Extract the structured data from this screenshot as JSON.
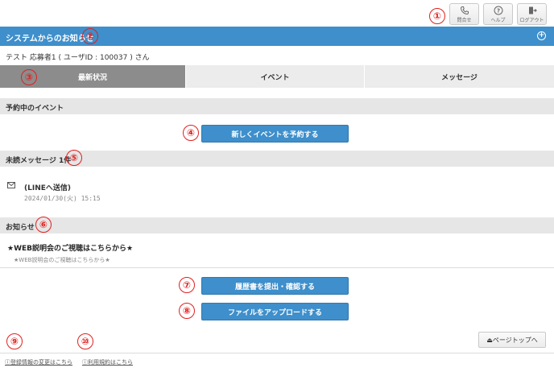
{
  "header": {
    "logo_text": "",
    "buttons": [
      {
        "label": "問合せ",
        "icon": "phone-icon"
      },
      {
        "label": "ヘルプ",
        "icon": "help-icon"
      },
      {
        "label": "ログアウト",
        "icon": "logout-icon"
      }
    ]
  },
  "banner": {
    "title": "システムからのお知らせ",
    "expand_icon": "plus-circle-icon"
  },
  "user_line": "テスト 応募者1 ( ユーザID : 100037 ) さん",
  "tabs": [
    {
      "label": "最新状況",
      "active": true
    },
    {
      "label": "イベント",
      "active": false
    },
    {
      "label": "メッセージ",
      "active": false
    }
  ],
  "sections": {
    "reserved_events": "予約中のイベント",
    "unread_messages": "未読メッセージ  1件",
    "notices": "お知らせ"
  },
  "buttons": {
    "reserve_event": "新しくイベントを予約する",
    "submit_resume": "履歴書を提出・確認する",
    "upload_file": "ファイルをアップロードする",
    "page_top": "⏏ページトップへ"
  },
  "message": {
    "title": "(LINEへ送信)",
    "date": "2024/01/30(火) 15:15"
  },
  "notice": {
    "title": "★WEB説明会のご視聴はこちらから★",
    "subtitle": "★WEB説明会のご視聴はこちらから★"
  },
  "footer": {
    "change_registration": "登録情報の変更はこちら",
    "terms": "利用規約はこちら"
  },
  "callouts": [
    "①",
    "②",
    "③",
    "④",
    "⑤",
    "⑥",
    "⑦",
    "⑧",
    "⑨",
    "⑩"
  ],
  "colors": {
    "accent": "#3e8fcb",
    "callout": "#e02020",
    "section_bg": "#e6e6e6",
    "active_tab": "#8c8c8c"
  }
}
